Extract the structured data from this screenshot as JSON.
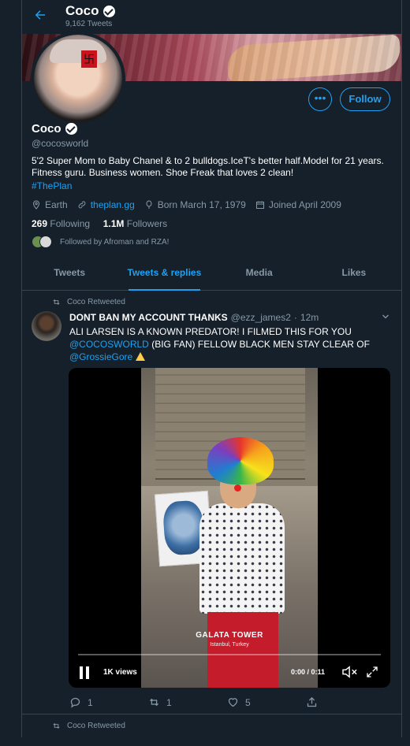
{
  "header": {
    "title": "Coco",
    "subtitle": "9,162 Tweets"
  },
  "profile": {
    "name": "Coco",
    "handle": "@cocosworld",
    "bio": "5'2 Super Mom to Baby Chanel & to 2 bulldogs.IceT's better half.Model for 21 years. Fitness guru. Business women. Shoe Freak that loves 2 clean!",
    "hashtag": "#ThePlan",
    "location": "Earth",
    "website": "theplan.gg",
    "birthday": "Born March 17, 1979",
    "joined": "Joined April 2009",
    "following_count": "269",
    "following_label": "Following",
    "followers_count": "1.1M",
    "followers_label": "Followers",
    "followed_by": "Followed by Afroman and RZA!",
    "more_label": "•••",
    "follow_label": "Follow"
  },
  "tabs": [
    {
      "label": "Tweets"
    },
    {
      "label": "Tweets & replies"
    },
    {
      "label": "Media"
    },
    {
      "label": "Likes"
    }
  ],
  "tweet": {
    "retweeted_by": "Coco Retweeted",
    "author_name": "DONT BAN MY ACCOUNT THANKS",
    "author_handle": "@ezz_james2",
    "sep": "·",
    "time": "12m",
    "text_line1": "ALI LARSEN IS A KNOWN PREDATOR! I FILMED THIS FOR YOU",
    "mention1": "@COCOSWORLD",
    "text_line2": " (BIG FAN) FELLOW BLACK MEN STAY CLEAR OF",
    "mention2": "@GrossieGore",
    "video": {
      "caption_title": "GALATA TOWER",
      "caption_sub": "Istanbul, Turkey",
      "views": "1K views",
      "time": "0:00 / 0:11",
      "progress": 0
    },
    "replies": "1",
    "retweets": "1",
    "likes": "5"
  },
  "tweet2": {
    "retweeted_by": "Coco Retweeted"
  },
  "colors": {
    "background": "#15202b",
    "accent": "#1da1f2",
    "muted": "#8899a6",
    "border": "#38444d"
  }
}
